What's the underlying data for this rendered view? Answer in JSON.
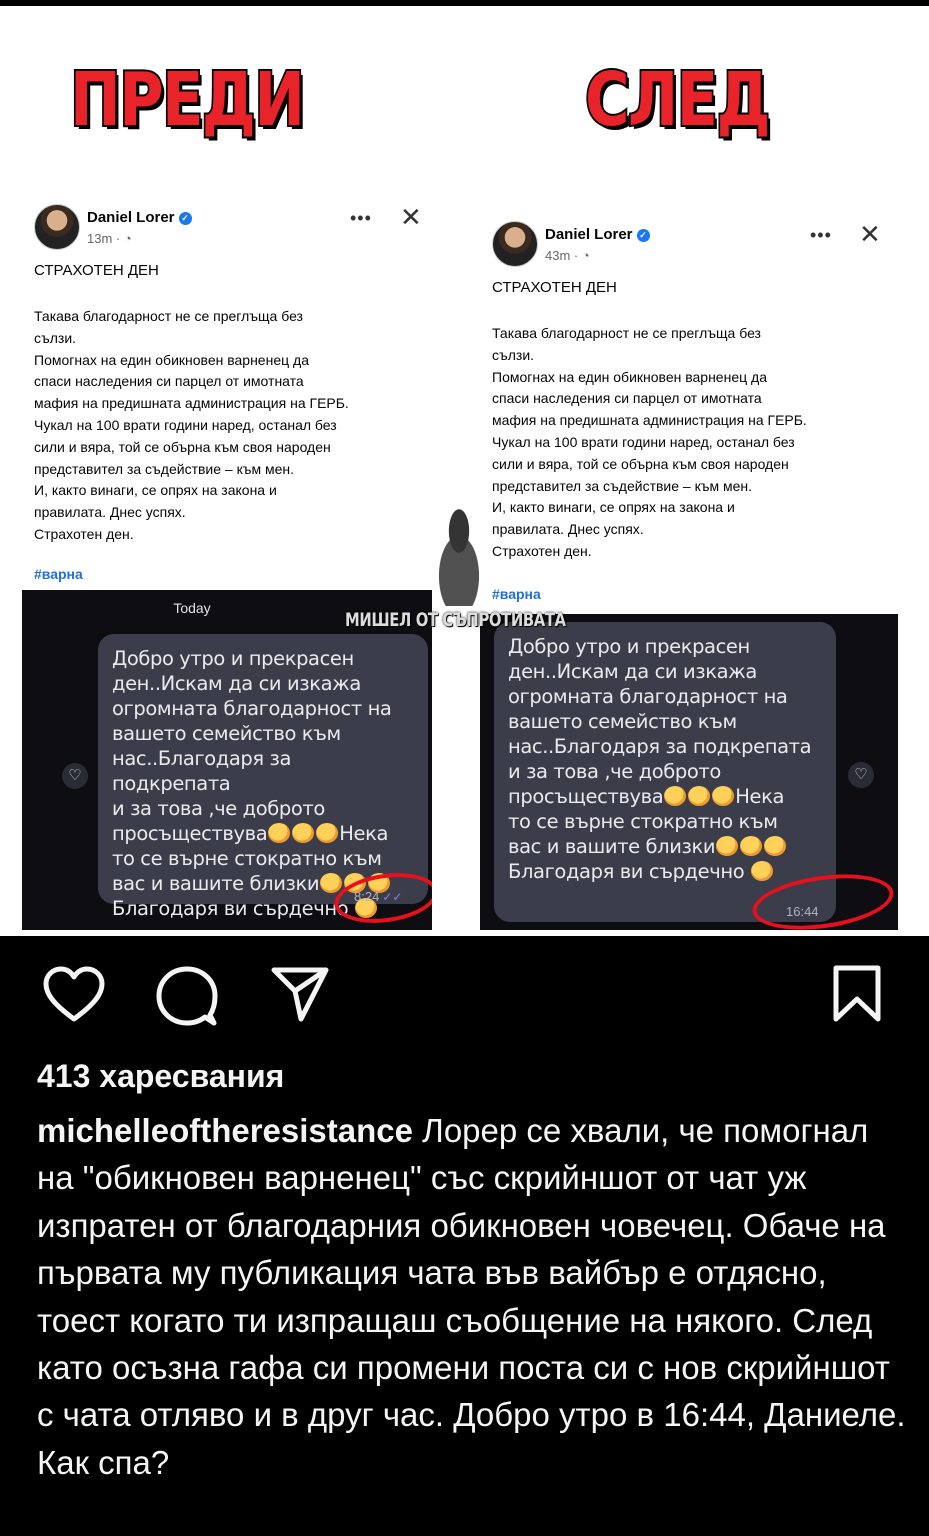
{
  "labels": {
    "before": "ПРЕДИ",
    "after": "СЛЕД"
  },
  "post_before": {
    "author": "Daniel Lorer",
    "meta": "13m · ",
    "headline": "СТРАХОТЕН ДЕН",
    "body": "Такава благодарност не се преглъща без\nсълзи.\nПомогнах на един обикновен варненец да\nспаси наследения си парцел от имотната\nмафия на предишната администрация на ГЕРБ.\nЧукал на 100 врати години наред, останал без\nсили и вяра, той се обърна към своя народен\nпредставител за съдействие – към мен.\nИ, както винаги, се опрях на закона и\nправилата.  Днес успях.\nСтрахотен ден.",
    "hashtag": "#варна"
  },
  "post_after": {
    "author": "Daniel Lorer",
    "meta": "43m · ",
    "headline": "СТРАХОТЕН ДЕН",
    "body": "Такава благодарност не се преглъща без\nсълзи.\nПомогнах на един обикновен варненец да\nспаси наследения си парцел от имотната\nмафия на предишната администрация на ГЕРБ.\nЧукал на 100 врати години наред, останал без\nсили и вяра, той се обърна към своя народен\nпредставител за съдействие – към мен.\nИ, както винаги, се опрях на закона и\nправилата.  Днес успях.\nСтрахотен ден.",
    "hashtag": "#варна"
  },
  "chat_before": {
    "day": "Today",
    "message_lines": [
      "Добро утро и прекрасен",
      "ден..Искам да си изкажа",
      "огромната благодарност на",
      "вашето   семейство към",
      "нас..Благодаря за подкрепата",
      "и за това  ,че доброто",
      "просъществува",
      "то се върне стократно  към",
      "вас и  вашите близки",
      "Благодаря ви сърдечно "
    ],
    "line7_suffix": "Нека",
    "time": "8:24"
  },
  "chat_after": {
    "message_lines": [
      "Добро утро и прекрасен",
      "ден..Искам да си изкажа",
      "огромната благодарност на",
      "вашето   семейство към",
      "нас..Благодаря за подкрепата",
      "и за това  ,че доброто",
      "просъществува",
      "то се върне стократно  към",
      "вас и  вашите близки",
      "Благодаря ви сърдечно "
    ],
    "line7_suffix": "Нека",
    "time": "16:44"
  },
  "watermark": "МИШЕЛ ОТ СЪПРОТИВАТА",
  "instagram": {
    "likes": "413 харесвания",
    "username": "michelleoftheresistance",
    "caption": " Лорер се хвали, че помогнал на \"обикновен варненец\" със скрийншот от чат уж изпратен от благодарния обикновен човечец. Обаче на първата му публикация чата във вайбър е отдясно, тоест когато ти изпращаш съобщение на някого. След като осъзна гафа си промени поста си с нов скрийншот с чата отляво и в друг час. Добро утро в 16:44, Даниеле. Как спа?"
  },
  "colors": {
    "accent_red": "#e8242a",
    "fb_blue": "#1877f2",
    "bubble": "#3b3e4a"
  }
}
